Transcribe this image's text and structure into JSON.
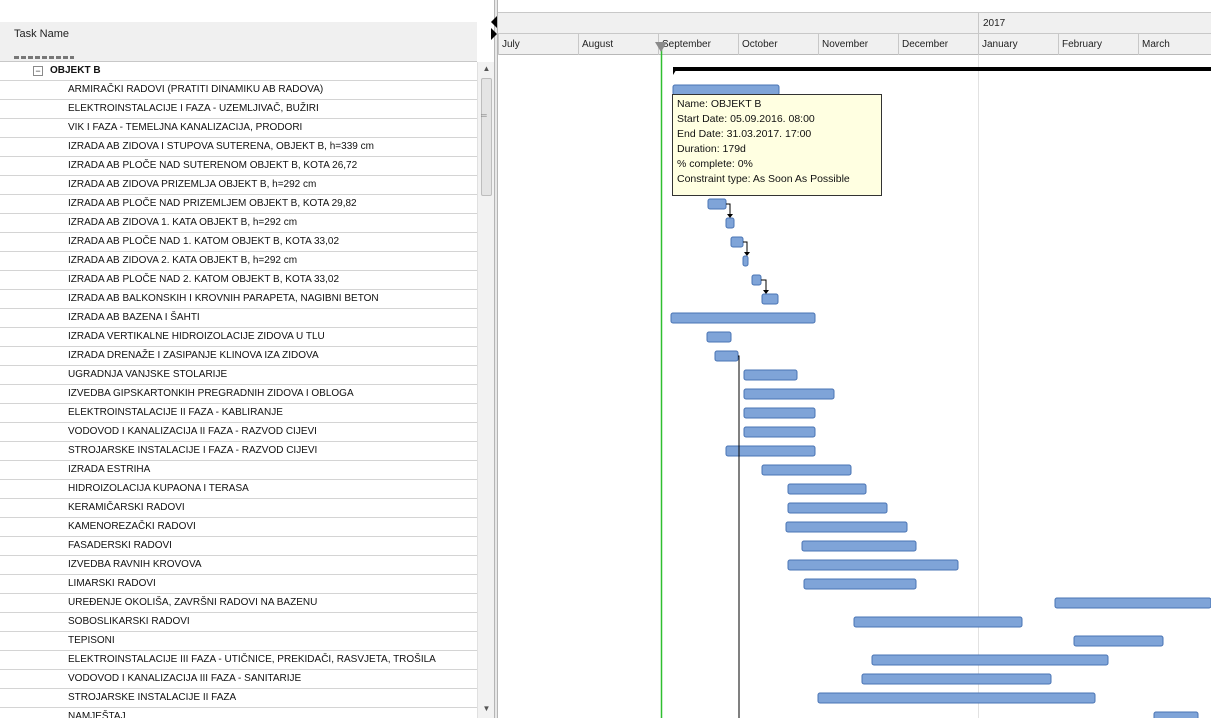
{
  "task_header": "Task Name",
  "timescale": {
    "year": "2017",
    "months": [
      "July",
      "August",
      "September",
      "October",
      "November",
      "December",
      "January",
      "February",
      "March"
    ]
  },
  "rows": [
    {
      "name": "OBJEKT B",
      "group": true,
      "toggle": "−"
    },
    {
      "name": "ARMIRAČKI RADOVI (PRATITI DINAMIKU AB RADOVA)"
    },
    {
      "name": "ELEKTROINSTALACIJE I FAZA - UZEMLJIVAČ, BUŽIRI"
    },
    {
      "name": "VIK I FAZA - TEMELJNA KANALIZACIJA, PRODORI"
    },
    {
      "name": "IZRADA AB ZIDOVA I STUPOVA SUTERENA, OBJEKT B, h=339 cm"
    },
    {
      "name": "IZRADA AB PLOČE NAD SUTERENOM OBJEKT B, KOTA 26,72"
    },
    {
      "name": "IZRADA AB ZIDOVA PRIZEMLJA OBJEKT B, h=292 cm"
    },
    {
      "name": "IZRADA AB PLOČE NAD PRIZEMLJEM OBJEKT B, KOTA 29,82"
    },
    {
      "name": "IZRADA AB ZIDOVA 1. KATA OBJEKT B, h=292 cm"
    },
    {
      "name": "IZRADA AB PLOČE NAD 1. KATOM OBJEKT B, KOTA 33,02"
    },
    {
      "name": "IZRADA AB ZIDOVA 2. KATA OBJEKT B, h=292 cm"
    },
    {
      "name": "IZRADA AB PLOČE NAD 2. KATOM OBJEKT B, KOTA 33,02"
    },
    {
      "name": "IZRADA AB BALKONSKIH I KROVNIH PARAPETA, NAGIBNI BETON"
    },
    {
      "name": "IZRADA AB BAZENA I ŠAHTI"
    },
    {
      "name": "IZRADA VERTIKALNE HIDROIZOLACIJE ZIDOVA U TLU"
    },
    {
      "name": "IZRADA DRENAŽE I ZASIPANJE KLINOVA IZA ZIDOVA"
    },
    {
      "name": "UGRADNJA VANJSKE STOLARIJE"
    },
    {
      "name": "IZVEDBA GIPSKARTONKIH PREGRADNIH ZIDOVA I OBLOGA"
    },
    {
      "name": "ELEKTROINSTALACIJE II FAZA - KABLIRANJE"
    },
    {
      "name": "VODOVOD I KANALIZACIJA II FAZA - RAZVOD CIJEVI"
    },
    {
      "name": "STROJARSKE INSTALACIJE I FAZA - RAZVOD CIJEVI"
    },
    {
      "name": "IZRADA ESTRIHA"
    },
    {
      "name": "HIDROIZOLACIJA KUPAONA I TERASA"
    },
    {
      "name": "KERAMIČARSKI RADOVI"
    },
    {
      "name": "KAMENOREZAČKI RADOVI"
    },
    {
      "name": "FASADERSKI RADOVI"
    },
    {
      "name": "IZVEDBA RAVNIH KROVOVA"
    },
    {
      "name": "LIMARSKI RADOVI"
    },
    {
      "name": "UREĐENJE OKOLIŠA, ZAVRŠNI RADOVI NA BAZENU"
    },
    {
      "name": "SOBOSLIKARSKI RADOVI"
    },
    {
      "name": "TEPISONI"
    },
    {
      "name": "ELEKTROINSTALACIJE III FAZA - UTIČNICE, PREKIDAČI, RASVJETA, TROŠILA"
    },
    {
      "name": "VODOVOD I KANALIZACIJA III FAZA - SANITARIJE"
    },
    {
      "name": "STROJARSKE INSTALACIJE II FAZA"
    },
    {
      "name": "NAMJEŠTAJ"
    }
  ],
  "tooltip": {
    "name": "Name: OBJEKT B",
    "start": "Start Date: 05.09.2016. 08:00",
    "end": "End Date: 31.03.2017. 17:00",
    "duration": "Duration: 179d",
    "complete": "% complete: 0%",
    "constraint": "Constraint type: As Soon As Possible"
  },
  "colors": {
    "bar_fill": "#7fa4d8",
    "bar_stroke": "#4a74b4",
    "summary": "#000000",
    "today_line": "#2fbf2f",
    "tooltip_bg": "#ffffe1"
  }
}
